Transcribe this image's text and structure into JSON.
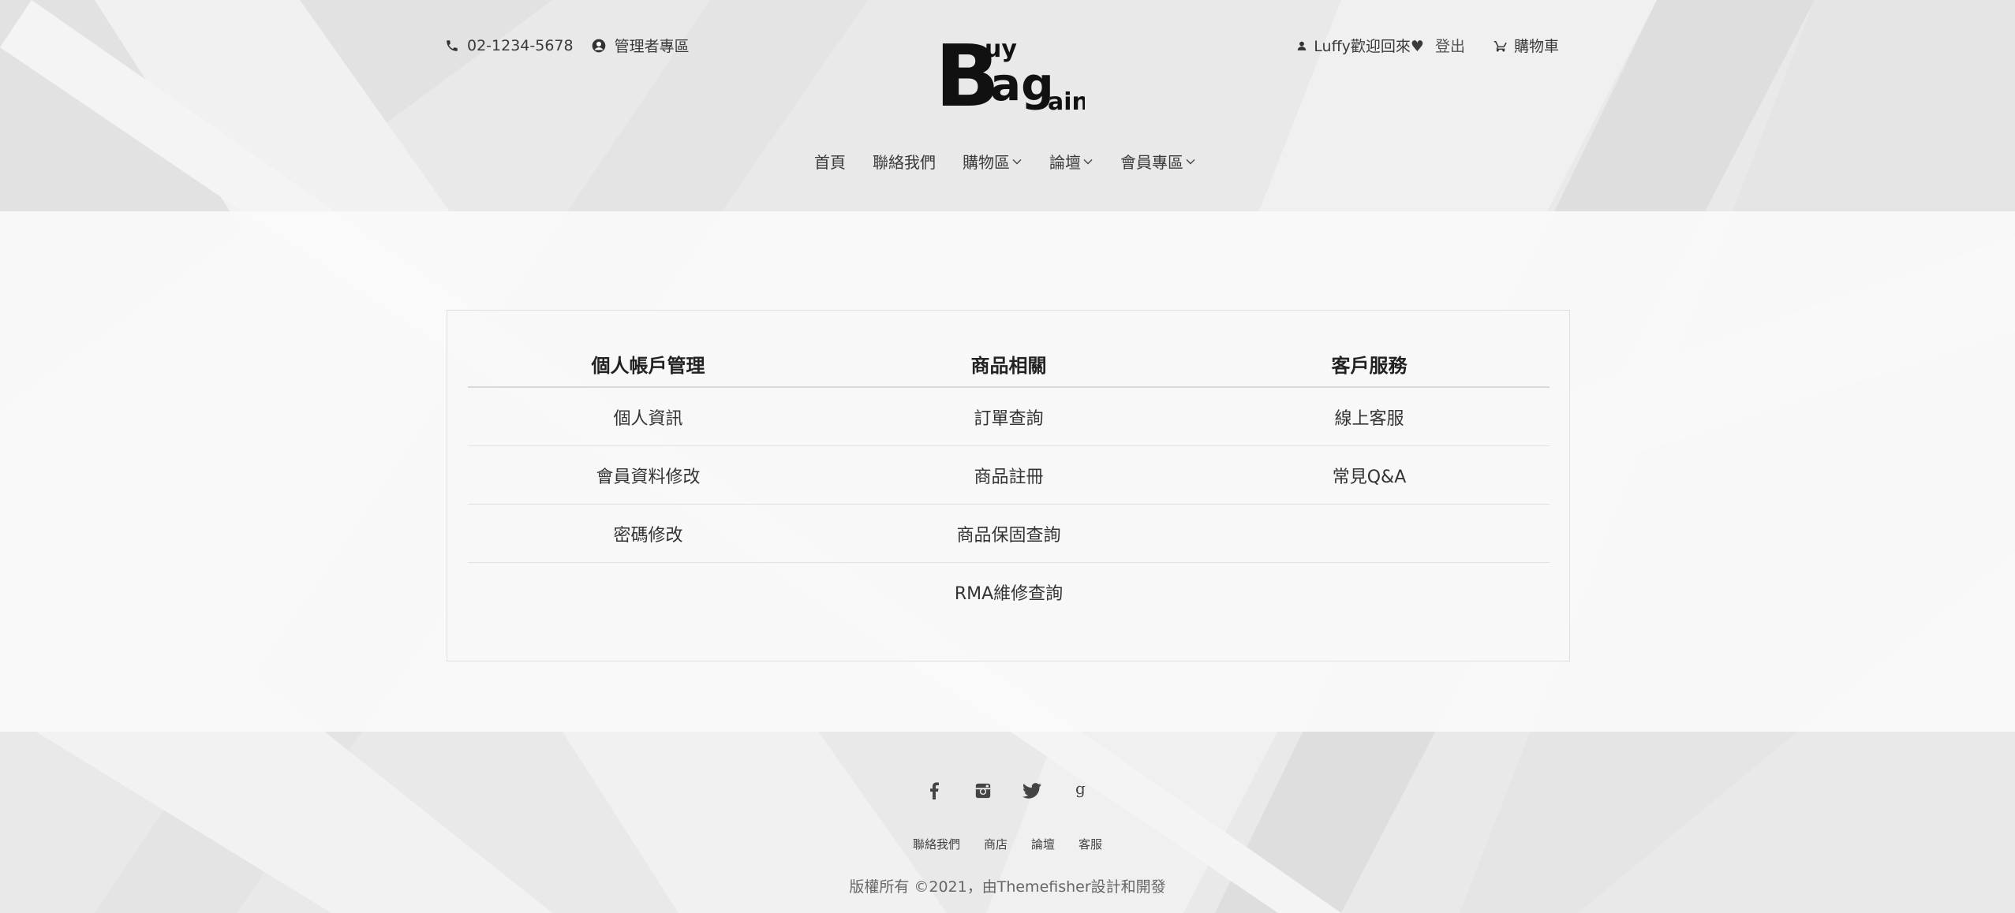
{
  "header": {
    "phone": "02-1234-5678",
    "admin_link": "管理者專區",
    "welcome": "Luffy歡迎回來♥",
    "logout": "登出",
    "cart": "購物車",
    "logo": {
      "big_letter": "B",
      "top_letters": "uy",
      "mid_letters": "ag",
      "small_letters": "ain"
    }
  },
  "nav": {
    "items": [
      {
        "label": "首頁"
      },
      {
        "label": "聯絡我們"
      },
      {
        "label": "購物區"
      },
      {
        "label": "論壇"
      },
      {
        "label": "會員專區"
      }
    ]
  },
  "member_menu": {
    "columns": [
      "個人帳戶管理",
      "商品相關",
      "客戶服務"
    ],
    "rows": [
      [
        "個人資訊",
        "訂單查詢",
        "線上客服"
      ],
      [
        "會員資料修改",
        "商品註冊",
        "常見Q&A"
      ],
      [
        "密碼修改",
        "商品保固查詢",
        ""
      ],
      [
        "",
        "RMA維修查詢",
        ""
      ]
    ]
  },
  "footer": {
    "social": [
      {
        "icon": "facebook-icon",
        "glyph": "f"
      },
      {
        "icon": "instagram-icon",
        "glyph": ""
      },
      {
        "icon": "twitter-icon",
        "glyph": ""
      },
      {
        "icon": "google-icon",
        "glyph": "g"
      }
    ],
    "links": [
      "聯絡我們",
      "商店",
      "論壇",
      "客服"
    ],
    "copyright": "版權所有 ©2021，由Themefisher設計和開發"
  }
}
